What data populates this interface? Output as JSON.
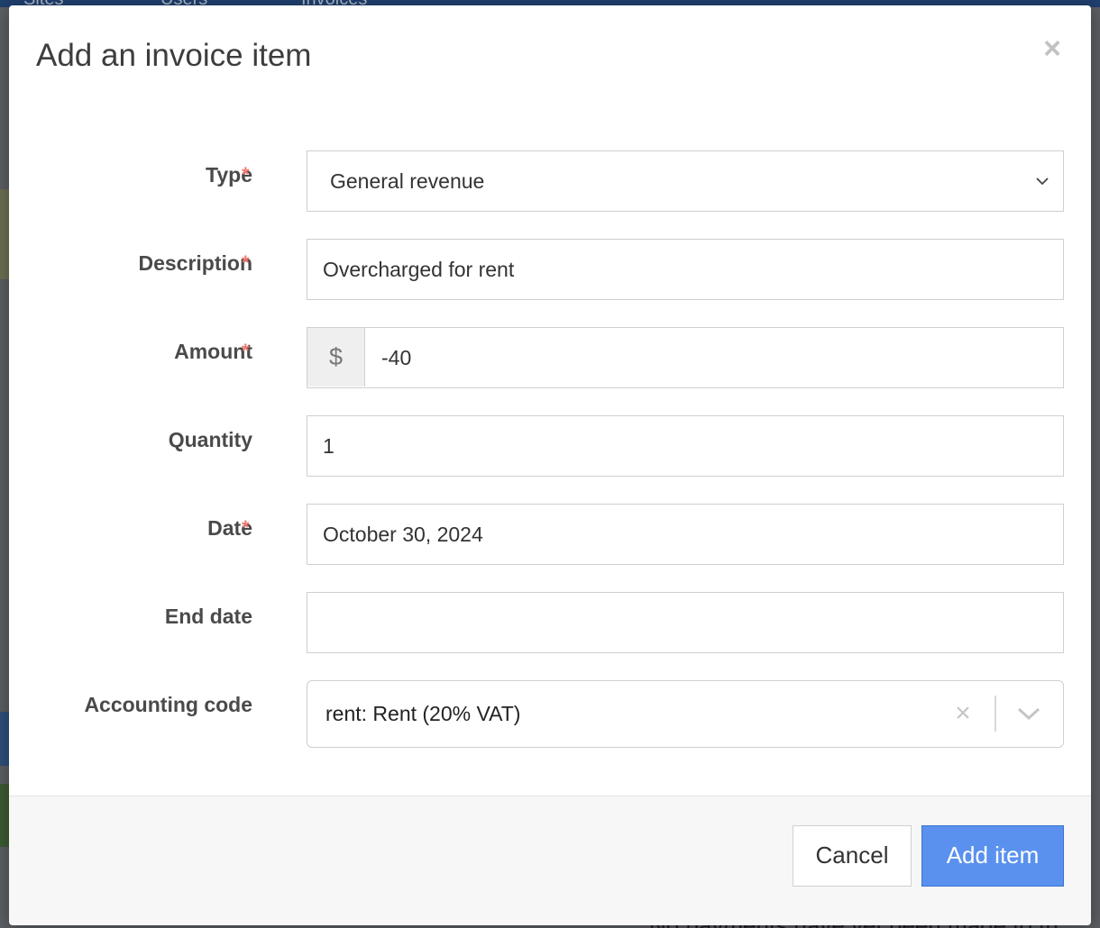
{
  "background": {
    "nav_items": [
      "Sites",
      "Users",
      "Invoices"
    ],
    "footer_text": "No payments have yet been made to th"
  },
  "modal": {
    "title": "Add an invoice item",
    "close_icon": "close-icon"
  },
  "form": {
    "required_marker": "*",
    "type": {
      "label": "Type",
      "required": true,
      "value": "General revenue"
    },
    "description": {
      "label": "Description",
      "required": true,
      "value": "Overcharged for rent"
    },
    "amount": {
      "label": "Amount",
      "required": true,
      "currency_symbol": "$",
      "value": "-40"
    },
    "quantity": {
      "label": "Quantity",
      "required": false,
      "value": "1"
    },
    "date": {
      "label": "Date",
      "required": true,
      "value": "October 30, 2024"
    },
    "end_date": {
      "label": "End date",
      "required": false,
      "value": ""
    },
    "accounting_code": {
      "label": "Accounting code",
      "required": false,
      "value": "rent: Rent (20% VAT)",
      "clear_icon": "×"
    }
  },
  "footer": {
    "cancel_label": "Cancel",
    "add_label": "Add item"
  },
  "colors": {
    "accent": "#5a91ee",
    "required": "#f07b6e"
  }
}
